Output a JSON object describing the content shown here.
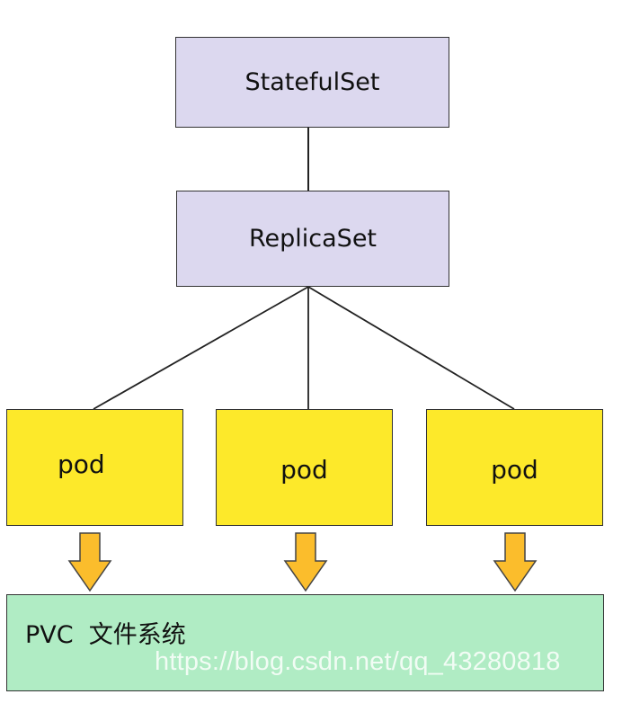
{
  "diagram": {
    "nodes": {
      "statefulset": "StatefulSet",
      "replicaset": "ReplicaSet",
      "pods": [
        "pod",
        "pod",
        "pod"
      ],
      "storage": "PVC  文件系统"
    },
    "edges": [
      {
        "from": "statefulset",
        "to": "replicaset",
        "style": "line"
      },
      {
        "from": "replicaset",
        "to": "pod-1",
        "style": "line"
      },
      {
        "from": "replicaset",
        "to": "pod-2",
        "style": "line"
      },
      {
        "from": "replicaset",
        "to": "pod-3",
        "style": "line"
      },
      {
        "from": "pod-1",
        "to": "storage",
        "style": "block-arrow"
      },
      {
        "from": "pod-2",
        "to": "storage",
        "style": "block-arrow"
      },
      {
        "from": "pod-3",
        "to": "storage",
        "style": "block-arrow"
      }
    ],
    "colors": {
      "controller_fill": "#dcd8ef",
      "pod_fill": "#fde92a",
      "storage_fill": "#b0ecc4",
      "arrow_fill": "#fbbd2c",
      "line": "#222222"
    }
  },
  "watermark": "https://blog.csdn.net/qq_43280818"
}
